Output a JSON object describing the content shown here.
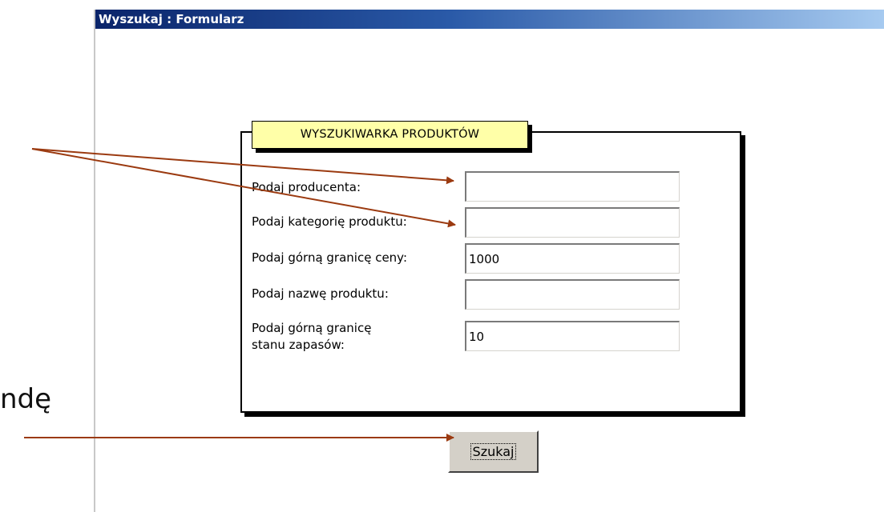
{
  "slide_text": "ndę",
  "window": {
    "title": "Wyszukaj : Formularz"
  },
  "form": {
    "group_title": "WYSZUKIWARKA PRODUKTÓW",
    "fields": [
      {
        "label": "Podaj producenta:",
        "value": ""
      },
      {
        "label": "Podaj kategorię produktu:",
        "value": ""
      },
      {
        "label": "Podaj górną granicę ceny:",
        "value": "1000"
      },
      {
        "label": "Podaj nazwę produktu:",
        "value": ""
      },
      {
        "label_line1": "Podaj górną granicę",
        "label_line2": "stanu zapasów:",
        "value": "10"
      }
    ],
    "search_button": "Szukaj"
  },
  "colors": {
    "title_bar_start": "#0a246a",
    "title_bar_end": "#a6caf0",
    "group_label_bg": "#ffffa8",
    "arrow": "#9b3a10",
    "button_face": "#d4d0c8"
  }
}
